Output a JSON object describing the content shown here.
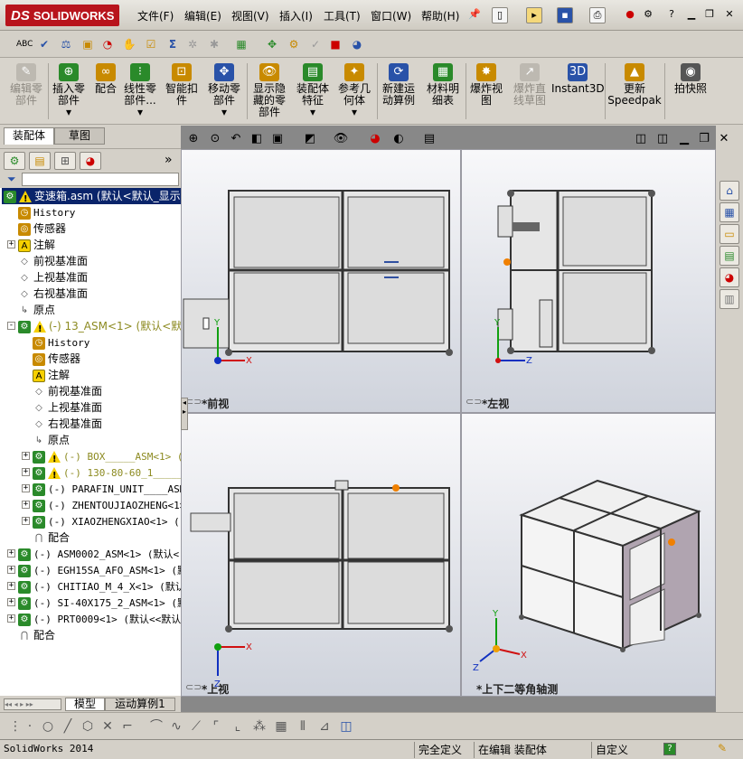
{
  "app": {
    "logo_ds": "DS",
    "logo_text": "SOLIDWORKS"
  },
  "menu": [
    "文件(F)",
    "编辑(E)",
    "视图(V)",
    "插入(I)",
    "工具(T)",
    "窗口(W)",
    "帮助(H)"
  ],
  "command_manager": {
    "buttons": [
      {
        "label": "编辑零\n部件",
        "disabled": true
      },
      {
        "label": "插入零\n部件\n▾",
        "disabled": false
      },
      {
        "label": "配合",
        "disabled": false
      },
      {
        "label": "线性零\n部件...\n▾",
        "disabled": false
      },
      {
        "label": "智能扣\n件",
        "disabled": false
      },
      {
        "label": "移动零\n部件\n▾",
        "disabled": false
      },
      {
        "label": "显示隐\n藏的零\n部件",
        "disabled": false
      },
      {
        "label": "装配体\n特征\n▾",
        "disabled": false
      },
      {
        "label": "参考几\n何体\n▾",
        "disabled": false
      },
      {
        "label": "新建运\n动算例",
        "disabled": false
      },
      {
        "label": "材料明\n细表",
        "disabled": false
      },
      {
        "label": "爆炸视\n图",
        "disabled": false
      },
      {
        "label": "爆炸直\n线草图",
        "disabled": true
      },
      {
        "label": "Instant3D",
        "disabled": false
      },
      {
        "label": "更新\nSpeedpak",
        "disabled": false
      },
      {
        "label": "拍快照",
        "disabled": false
      }
    ]
  },
  "left_panel": {
    "tabs": [
      "装配体",
      "草图"
    ],
    "expand_arrow": "»",
    "tree": [
      {
        "text": "变速箱.asm  (默认<默认_显示",
        "level": 0,
        "icon": "assembly",
        "warn": true,
        "selected": true
      },
      {
        "text": "History",
        "level": 1,
        "icon": "history",
        "mono": true
      },
      {
        "text": "传感器",
        "level": 1,
        "icon": "sensor"
      },
      {
        "text": "注解",
        "level": 1,
        "icon": "annotation",
        "expand": "+"
      },
      {
        "text": "前视基准面",
        "level": 1,
        "icon": "plane"
      },
      {
        "text": "上视基准面",
        "level": 1,
        "icon": "plane"
      },
      {
        "text": "右视基准面",
        "level": 1,
        "icon": "plane"
      },
      {
        "text": "原点",
        "level": 1,
        "icon": "origin"
      },
      {
        "text": "(-) 13_ASM<1> (默认<默认",
        "level": 1,
        "icon": "assembly",
        "warn": true,
        "expand": "-",
        "olive": true
      },
      {
        "text": "History",
        "level": 2,
        "icon": "history",
        "mono": true
      },
      {
        "text": "传感器",
        "level": 2,
        "icon": "sensor"
      },
      {
        "text": "注解",
        "level": 2,
        "icon": "annotation"
      },
      {
        "text": "前视基准面",
        "level": 2,
        "icon": "plane"
      },
      {
        "text": "上视基准面",
        "level": 2,
        "icon": "plane"
      },
      {
        "text": "右视基准面",
        "level": 2,
        "icon": "plane"
      },
      {
        "text": "原点",
        "level": 2,
        "icon": "origin"
      },
      {
        "text": "(-) BOX_____ASM<1> (",
        "level": 2,
        "icon": "assembly",
        "warn": true,
        "expand": "+",
        "olive": true,
        "mono": true
      },
      {
        "text": "(-) 130-80-60_1_________",
        "level": 2,
        "icon": "assembly",
        "warn": true,
        "expand": "+",
        "olive": true,
        "mono": true
      },
      {
        "text": "(-) PARAFIN_UNIT____ASM",
        "level": 2,
        "icon": "assembly",
        "expand": "+",
        "mono": true
      },
      {
        "text": "(-) ZHENTOUJIAOZHENG<1>",
        "level": 2,
        "icon": "assembly",
        "expand": "+",
        "mono": true
      },
      {
        "text": "(-) XIAOZHENGXIAO<1> (",
        "level": 2,
        "icon": "assembly",
        "expand": "+",
        "mono": true
      },
      {
        "text": "配合",
        "level": 2,
        "icon": "mates"
      },
      {
        "text": "(-) ASM0002_ASM<1> (默认<",
        "level": 1,
        "icon": "assembly",
        "expand": "+",
        "mono": true
      },
      {
        "text": "(-) EGH15SA_AFO_ASM<1> (默",
        "level": 1,
        "icon": "assembly",
        "expand": "+",
        "mono": true
      },
      {
        "text": "(-) CHITIAO_M_4_X<1> (默认",
        "level": 1,
        "icon": "assembly",
        "expand": "+",
        "mono": true
      },
      {
        "text": "(-) SI-40X175_2_ASM<1> (默",
        "level": 1,
        "icon": "assembly",
        "expand": "+",
        "mono": true
      },
      {
        "text": "(-) PRT0009<1> (默认<<默认",
        "level": 1,
        "icon": "assembly",
        "expand": "+",
        "mono": true
      },
      {
        "text": "配合",
        "level": 1,
        "icon": "mates"
      }
    ],
    "bottom_tabs": [
      "模型",
      "运动算例1"
    ]
  },
  "viewports": {
    "front": "*前视",
    "left": "*左视",
    "top": "*上视",
    "iso": "*上下二等角轴测"
  },
  "axes": {
    "x": "X",
    "y": "Y",
    "z": "Z"
  },
  "status": {
    "app": "SolidWorks 2014",
    "defined": "完全定义",
    "editing": "在编辑 装配体",
    "custom": "自定义",
    "help": "?"
  },
  "colors": {
    "title_red": "#b8141c",
    "accent_orange": "#f08000",
    "axis_x": "#d01010",
    "axis_y": "#10a010",
    "axis_z": "#1030c0",
    "panel": "#e6e6e6"
  }
}
